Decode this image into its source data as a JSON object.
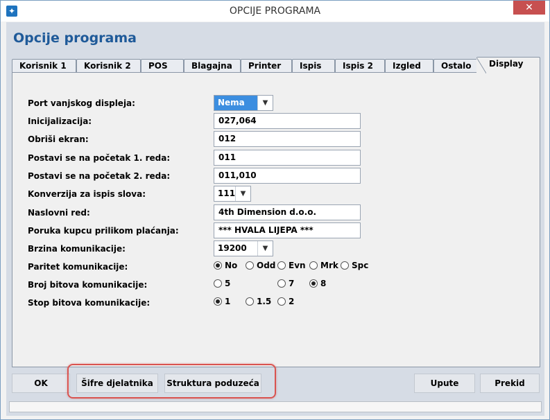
{
  "window": {
    "title": "OPCIJE PROGRAMA",
    "close_label": "✕"
  },
  "heading": "Opcije programa",
  "tabs": [
    {
      "label": "Korisnik 1"
    },
    {
      "label": "Korisnik 2"
    },
    {
      "label": "POS"
    },
    {
      "label": "Blagajna"
    },
    {
      "label": "Printer"
    },
    {
      "label": "Ispis"
    },
    {
      "label": "Ispis 2"
    },
    {
      "label": "Izgled"
    },
    {
      "label": "Ostalo"
    },
    {
      "label": "Display",
      "active": true
    }
  ],
  "form": {
    "port_label": "Port vanjskog displeja:",
    "port_value": "Nema",
    "init_label": "Inicijalizacija:",
    "init_value": "027,064",
    "clear_label": "Obriši ekran:",
    "clear_value": "012",
    "line1_label": "Postavi se na početak 1. reda:",
    "line1_value": "011",
    "line2_label": "Postavi se na početak 2. reda:",
    "line2_value": "011,010",
    "conversion_label": "Konverzija za ispis slova:",
    "conversion_value": "111",
    "title_row_label": "Naslovni red:",
    "title_row_value": "4th Dimension d.o.o.",
    "message_label": "Poruka kupcu prilikom plaćanja:",
    "message_value": "*** HVALA LIJEPA ***",
    "baud_label": "Brzina komunikacije:",
    "baud_value": "19200",
    "parity_label": "Paritet komunikacije:",
    "parity_options": [
      {
        "label": "No",
        "checked": true
      },
      {
        "label": "Odd",
        "checked": false
      },
      {
        "label": "Evn",
        "checked": false
      },
      {
        "label": "Mrk",
        "checked": false
      },
      {
        "label": "Spc",
        "checked": false
      }
    ],
    "bits_label": "Broj bitova komunikacije:",
    "bits_options": [
      {
        "label": "5",
        "checked": false
      },
      {
        "label": "7",
        "checked": false
      },
      {
        "label": "8",
        "checked": true
      }
    ],
    "stop_label": "Stop bitova komunikacije:",
    "stop_options": [
      {
        "label": "1",
        "checked": true
      },
      {
        "label": "1.5",
        "checked": false
      },
      {
        "label": "2",
        "checked": false
      }
    ]
  },
  "buttons": {
    "ok": "OK",
    "sifre": "Šifre djelatnika",
    "struktura": "Struktura poduzeća",
    "upute": "Upute",
    "prekid": "Prekid"
  },
  "colors": {
    "accent": "#1f5a99",
    "highlight": "#d9534f",
    "selected": "#3c8ee0"
  }
}
